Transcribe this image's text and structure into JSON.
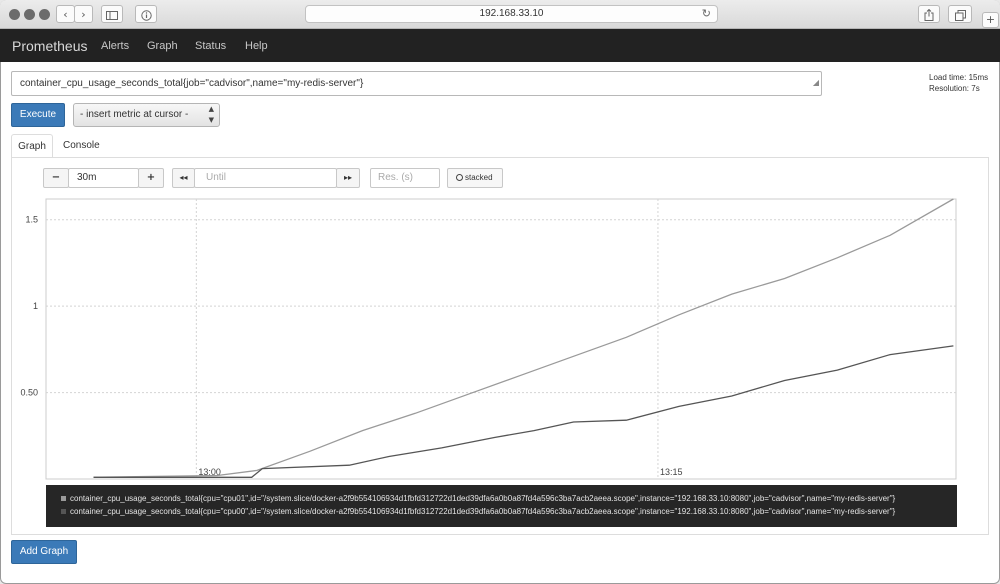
{
  "browser": {
    "url": "192.168.33.10",
    "back_icon": "chevron-left-icon",
    "forward_icon": "chevron-right-icon"
  },
  "nav": {
    "brand": "Prometheus",
    "links": [
      "Alerts",
      "Graph",
      "Status",
      "Help"
    ]
  },
  "query": {
    "expression": "container_cpu_usage_seconds_total{job=\"cadvisor\",name=\"my-redis-server\"}",
    "load_time": "Load time: 15ms",
    "resolution": "Resolution: 7s",
    "execute_label": "Execute",
    "metric_select": "- insert metric at cursor -"
  },
  "tabs": [
    "Graph",
    "Console"
  ],
  "controls": {
    "minus": "−",
    "range": "30m",
    "plus": "+",
    "back": "◂◂",
    "until_placeholder": "Until",
    "forward": "▸▸",
    "res_placeholder": "Res. (s)",
    "stacked": "stacked"
  },
  "chart_data": {
    "type": "line",
    "ylim": [
      0,
      1.62
    ],
    "yticks": [
      0.5,
      1,
      1.5
    ],
    "ytick_labels": [
      "0.50",
      "1",
      "1.5"
    ],
    "xlim": [
      0,
      34.5
    ],
    "xticks": [
      5.7,
      23.2
    ],
    "xtick_labels": [
      "13:00",
      "13:15"
    ],
    "grid": true,
    "series": [
      {
        "name": "container_cpu_usage_seconds_total{cpu=\"cpu01\",id=\"/system.slice/docker-a2f9b554106934d1fbfd312722d1ded39dfa6a0b0a87fd4a596c3ba7acb2aeea.scope\",instance=\"192.168.33.10:8080\",job=\"cadvisor\",name=\"my-redis-server\"}",
        "color": "#9a9a9a",
        "x": [
          1.8,
          6.5,
          8,
          10,
          12,
          14,
          16,
          18,
          20,
          22,
          24,
          26,
          28,
          30,
          32,
          34.4
        ],
        "y": [
          0.01,
          0.02,
          0.05,
          0.16,
          0.28,
          0.38,
          0.49,
          0.6,
          0.71,
          0.82,
          0.95,
          1.07,
          1.16,
          1.28,
          1.41,
          1.62
        ]
      },
      {
        "name": "container_cpu_usage_seconds_total{cpu=\"cpu00\",id=\"/system.slice/docker-a2f9b554106934d1fbfd312722d1ded39dfa6a0b0a87fd4a596c3ba7acb2aeea.scope\",instance=\"192.168.33.10:8080\",job=\"cadvisor\",name=\"my-redis-server\"}",
        "color": "#555555",
        "x": [
          1.8,
          7.8,
          8.2,
          11.5,
          13,
          15,
          17,
          18.5,
          20,
          22,
          24,
          26,
          28,
          30,
          32,
          34.4
        ],
        "y": [
          0.01,
          0.01,
          0.06,
          0.08,
          0.13,
          0.18,
          0.24,
          0.28,
          0.33,
          0.34,
          0.42,
          0.48,
          0.57,
          0.63,
          0.72,
          0.77
        ]
      }
    ]
  },
  "legend_swatches": [
    "#9a9a9a",
    "#555555"
  ],
  "add_graph_label": "Add Graph"
}
